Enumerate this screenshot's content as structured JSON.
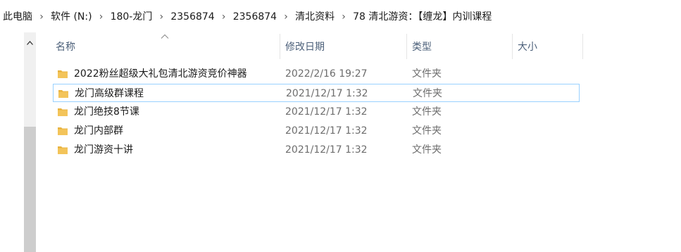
{
  "breadcrumb": [
    {
      "label": "此电脑"
    },
    {
      "label": "软件 (N:)"
    },
    {
      "label": "180-龙门"
    },
    {
      "label": "2356874"
    },
    {
      "label": "2356874"
    },
    {
      "label": "清北资料"
    },
    {
      "label": "78 清北游资：【缠龙】内训课程"
    }
  ],
  "columns": {
    "name": "名称",
    "modified": "修改日期",
    "type": "类型",
    "size": "大小"
  },
  "sort": {
    "column": "name",
    "direction": "ascending"
  },
  "files": [
    {
      "name": "2022粉丝超级大礼包清北游资竞价神器",
      "modified": "2022/2/16 19:27",
      "type": "文件夹",
      "icon": "folder-icon"
    },
    {
      "name": "龙门高级群课程",
      "modified": "2021/12/17 1:32",
      "type": "文件夹",
      "icon": "folder-icon"
    },
    {
      "name": "龙门绝技8节课",
      "modified": "2021/12/17 1:32",
      "type": "文件夹",
      "icon": "folder-icon"
    },
    {
      "name": "龙门内部群",
      "modified": "2021/12/17 1:32",
      "type": "文件夹",
      "icon": "folder-icon"
    },
    {
      "name": "龙门游资十讲",
      "modified": "2021/12/17 1:32",
      "type": "文件夹",
      "icon": "folder-icon"
    }
  ],
  "colors": {
    "folder": "#f3c45a",
    "focus_border": "#99d1ff",
    "header_text": "#4c607a",
    "secondary_text": "#6d6d6d"
  }
}
